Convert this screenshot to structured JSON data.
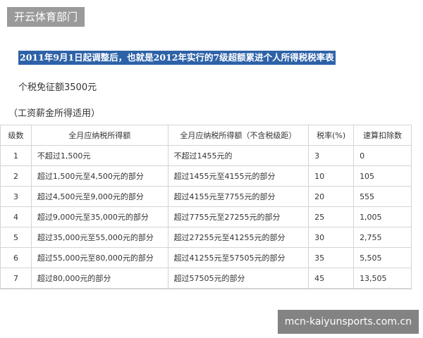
{
  "site_tag": "开云体育部门",
  "headline": "2011年9月1日起调整后，也就是2012年实行的7级超额累进个人所得税税率表",
  "exemption_text": "个税免征额3500元",
  "scope_text": "（工资薪金所得适用）",
  "table": {
    "headers": [
      "级数",
      "全月应纳税所得额",
      "全月应纳税所得额（不含税级距）",
      "税率(%)",
      "速算扣除数"
    ],
    "rows": [
      [
        "1",
        "不超过1,500元",
        "不超过1455元的",
        "3",
        "0"
      ],
      [
        "2",
        "超过1,500元至4,500元的部分",
        "超过1455元至4155元的部分",
        "10",
        "105"
      ],
      [
        "3",
        "超过4,500元至9,000元的部分",
        "超过4155元至7755元的部分",
        "20",
        "555"
      ],
      [
        "4",
        "超过9,000元至35,000元的部分",
        "超过7755元至27255元的部分",
        "25",
        "1,005"
      ],
      [
        "5",
        "超过35,000元至55,000元的部分",
        "超过27255元至41255元的部分",
        "30",
        "2,755"
      ],
      [
        "6",
        "超过55,000元至80,000元的部分",
        "超过41255元至57505元的部分",
        "35",
        "5,505"
      ],
      [
        "7",
        "超过80,000元的部分",
        "超过57505元的部分",
        "45",
        "13,505"
      ]
    ]
  },
  "watermark": "mcn-kaiyunsports.com.cn",
  "colors": {
    "headline_bg": "#2d62a8",
    "tag_bg": "#9a9a9a",
    "border": "#d4d4d4"
  }
}
